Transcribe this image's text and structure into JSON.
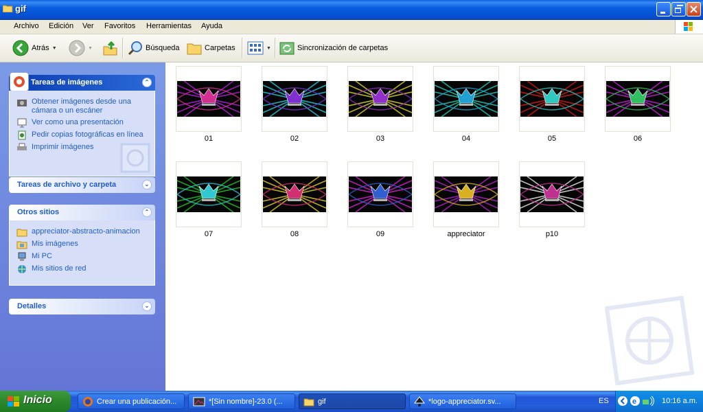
{
  "window": {
    "title": "gif"
  },
  "menu": [
    "Archivo",
    "Edición",
    "Ver",
    "Favoritos",
    "Herramientas",
    "Ayuda"
  ],
  "toolbar": {
    "back": "Atrás",
    "search": "Búsqueda",
    "folders": "Carpetas",
    "sync": "Sincronización de carpetas"
  },
  "sidebar": {
    "image_tasks": {
      "title": "Tareas de imágenes",
      "items": [
        "Obtener imágenes desde una cámara o un escáner",
        "Ver como una presentación",
        "Pedir copias fotográficas en línea",
        "Imprimir imágenes"
      ]
    },
    "file_tasks": {
      "title": "Tareas de archivo y carpeta"
    },
    "other_places": {
      "title": "Otros sitios",
      "items": [
        "appreciator-abstracto-animacion",
        "Mis imágenes",
        "Mi PC",
        "Mis sitios de red"
      ]
    },
    "details": {
      "title": "Detalles"
    }
  },
  "files": [
    {
      "name": "01",
      "colors": [
        "#b020d0",
        "#d03090"
      ]
    },
    {
      "name": "02",
      "colors": [
        "#20c8d8",
        "#8030d0"
      ]
    },
    {
      "name": "03",
      "colors": [
        "#d8d020",
        "#9030c8"
      ]
    },
    {
      "name": "04",
      "colors": [
        "#20c8b0",
        "#20a0d0"
      ]
    },
    {
      "name": "05",
      "colors": [
        "#d01818",
        "#30c8c0"
      ]
    },
    {
      "name": "06",
      "colors": [
        "#c020d0",
        "#30c060"
      ]
    },
    {
      "name": "07",
      "colors": [
        "#20c020",
        "#30c8d0"
      ]
    },
    {
      "name": "08",
      "colors": [
        "#d8c820",
        "#d03070"
      ]
    },
    {
      "name": "09",
      "colors": [
        "#d020d0",
        "#3060d0"
      ]
    },
    {
      "name": "appreciator",
      "colors": [
        "#b020c8",
        "#d8b020"
      ]
    },
    {
      "name": "p10",
      "colors": [
        "#e0e0e0",
        "#c03090"
      ]
    }
  ],
  "taskbar": {
    "start": "Inicio",
    "tasks": [
      "Crear una publicación...",
      "*[Sin nombre]-23.0 (...",
      "gif",
      "*logo-appreciator.sv..."
    ],
    "lang": "ES",
    "clock": "10:16 a.m."
  }
}
